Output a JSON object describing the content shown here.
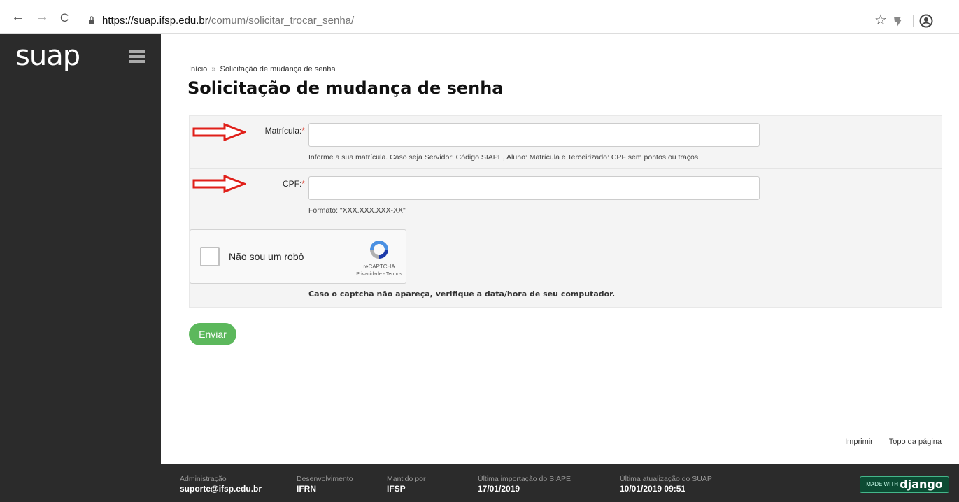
{
  "browser": {
    "back": "←",
    "forward": "→",
    "reload": "C",
    "url_host": "https://suap.ifsp.edu.br",
    "url_path": "/comum/solicitar_trocar_senha/",
    "bookmark_icon": "star-icon",
    "extension_icon": "extension-icon",
    "profile_icon": "profile-icon"
  },
  "sidebar": {
    "logo": "suap",
    "menu_icon": "hamburger-icon"
  },
  "breadcrumb": {
    "home": "Início",
    "separator": "»",
    "current": "Solicitação de mudança de senha"
  },
  "page_title": "Solicitação de mudança de senha",
  "form": {
    "matricula": {
      "label": "Matrícula:",
      "required_mark": "*",
      "value": "",
      "help": "Informe a sua matrícula. Caso seja Servidor: Código SIAPE, Aluno: Matrícula e Terceirizado: CPF sem pontos ou traços."
    },
    "cpf": {
      "label": "CPF:",
      "required_mark": "*",
      "value": "",
      "help": "Formato: \"XXX.XXX.XXX-XX\""
    },
    "captcha": {
      "checkbox_label": "Não sou um robô",
      "brand": "reCAPTCHA",
      "links": "Privacidade - Termos",
      "note": "Caso o captcha não apareça, verifique a data/hora de seu computador."
    },
    "submit_label": "Enviar"
  },
  "footer_links": {
    "print": "Imprimir",
    "top": "Topo da página"
  },
  "footer": {
    "admin_label": "Administração",
    "admin_value": "suporte@ifsp.edu.br",
    "dev_label": "Desenvolvimento",
    "dev_value": "IFRN",
    "maint_label": "Mantido por",
    "maint_value": "IFSP",
    "siape_label": "Última importação do SIAPE",
    "siape_value": "17/01/2019",
    "suap_label": "Última atualização do SUAP",
    "suap_value": "10/01/2019 09:51",
    "django_small": "MADE WITH",
    "django_big": "django"
  },
  "colors": {
    "sidebar_bg": "#2b2b2b",
    "button_green": "#5cb85c",
    "required_red": "#d9301f",
    "arrow_red": "#e0201a",
    "django_green": "#0c4b33"
  }
}
